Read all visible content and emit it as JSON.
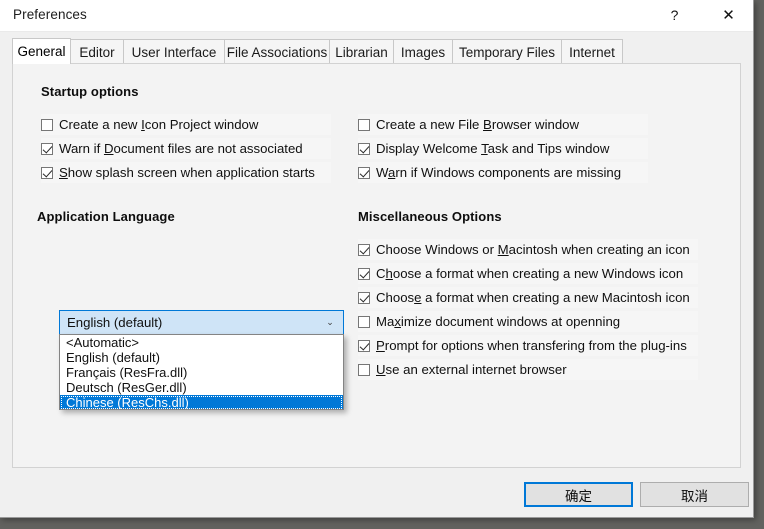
{
  "window": {
    "title": "Preferences",
    "help_icon": "?",
    "close_icon": "✕"
  },
  "tabs": [
    {
      "label": "General",
      "selected": true
    },
    {
      "label": "Editor",
      "selected": false
    },
    {
      "label": "User Interface",
      "selected": false
    },
    {
      "label": "File Associations",
      "selected": false
    },
    {
      "label": "Librarian",
      "selected": false
    },
    {
      "label": "Images",
      "selected": false
    },
    {
      "label": "Temporary Files",
      "selected": false
    },
    {
      "label": "Internet",
      "selected": false
    }
  ],
  "groups": {
    "startup_options": {
      "title": "Startup options",
      "left_items": [
        {
          "label_pre": "Create a new ",
          "accel": "I",
          "label_post": "con Project window",
          "checked": false
        },
        {
          "label_pre": "Warn if ",
          "accel": "D",
          "label_post": "ocument files are not associated",
          "checked": true
        },
        {
          "label_pre": "",
          "accel": "S",
          "label_post": "how splash screen when application starts",
          "checked": true
        }
      ],
      "right_items": [
        {
          "label_pre": "Create a new File ",
          "accel": "B",
          "label_post": "rowser window",
          "checked": false
        },
        {
          "label_pre": "Display Welcome ",
          "accel": "T",
          "label_post": "ask and Tips window",
          "checked": true
        },
        {
          "label_pre": "W",
          "accel": "a",
          "label_post": "rn if Windows components are missing",
          "checked": true
        }
      ]
    },
    "application_language": {
      "title": "Application Language",
      "selected_value": "English (default)",
      "arrow_icon": "⌄",
      "options": [
        {
          "label": "<Automatic>",
          "selected": false
        },
        {
          "label": "English (default)",
          "selected": false
        },
        {
          "label": "Français (ResFra.dll)",
          "selected": false
        },
        {
          "label": "Deutsch (ResGer.dll)",
          "selected": false
        },
        {
          "label": "Chinese (ResChs.dll)",
          "selected": true
        }
      ]
    },
    "miscellaneous_options": {
      "title": "Miscellaneous Options",
      "items": [
        {
          "label_pre": "Choose Windows or ",
          "accel": "M",
          "label_post": "acintosh when creating an icon",
          "checked": true
        },
        {
          "label_pre": "C",
          "accel": "h",
          "label_post": "oose a format when creating a new Windows icon",
          "checked": true
        },
        {
          "label_pre": "Choos",
          "accel": "e",
          "label_post": " a format when creating a new Macintosh icon",
          "checked": true
        },
        {
          "label_pre": "Ma",
          "accel": "x",
          "label_post": "imize document windows at openning",
          "checked": false
        },
        {
          "label_pre": "",
          "accel": "P",
          "label_post": "rompt for options when transfering from the plug-ins",
          "checked": true
        },
        {
          "label_pre": "",
          "accel": "U",
          "label_post": "se an external internet browser",
          "checked": false
        }
      ]
    }
  },
  "buttons": {
    "ok": "确定",
    "cancel": "取消"
  }
}
